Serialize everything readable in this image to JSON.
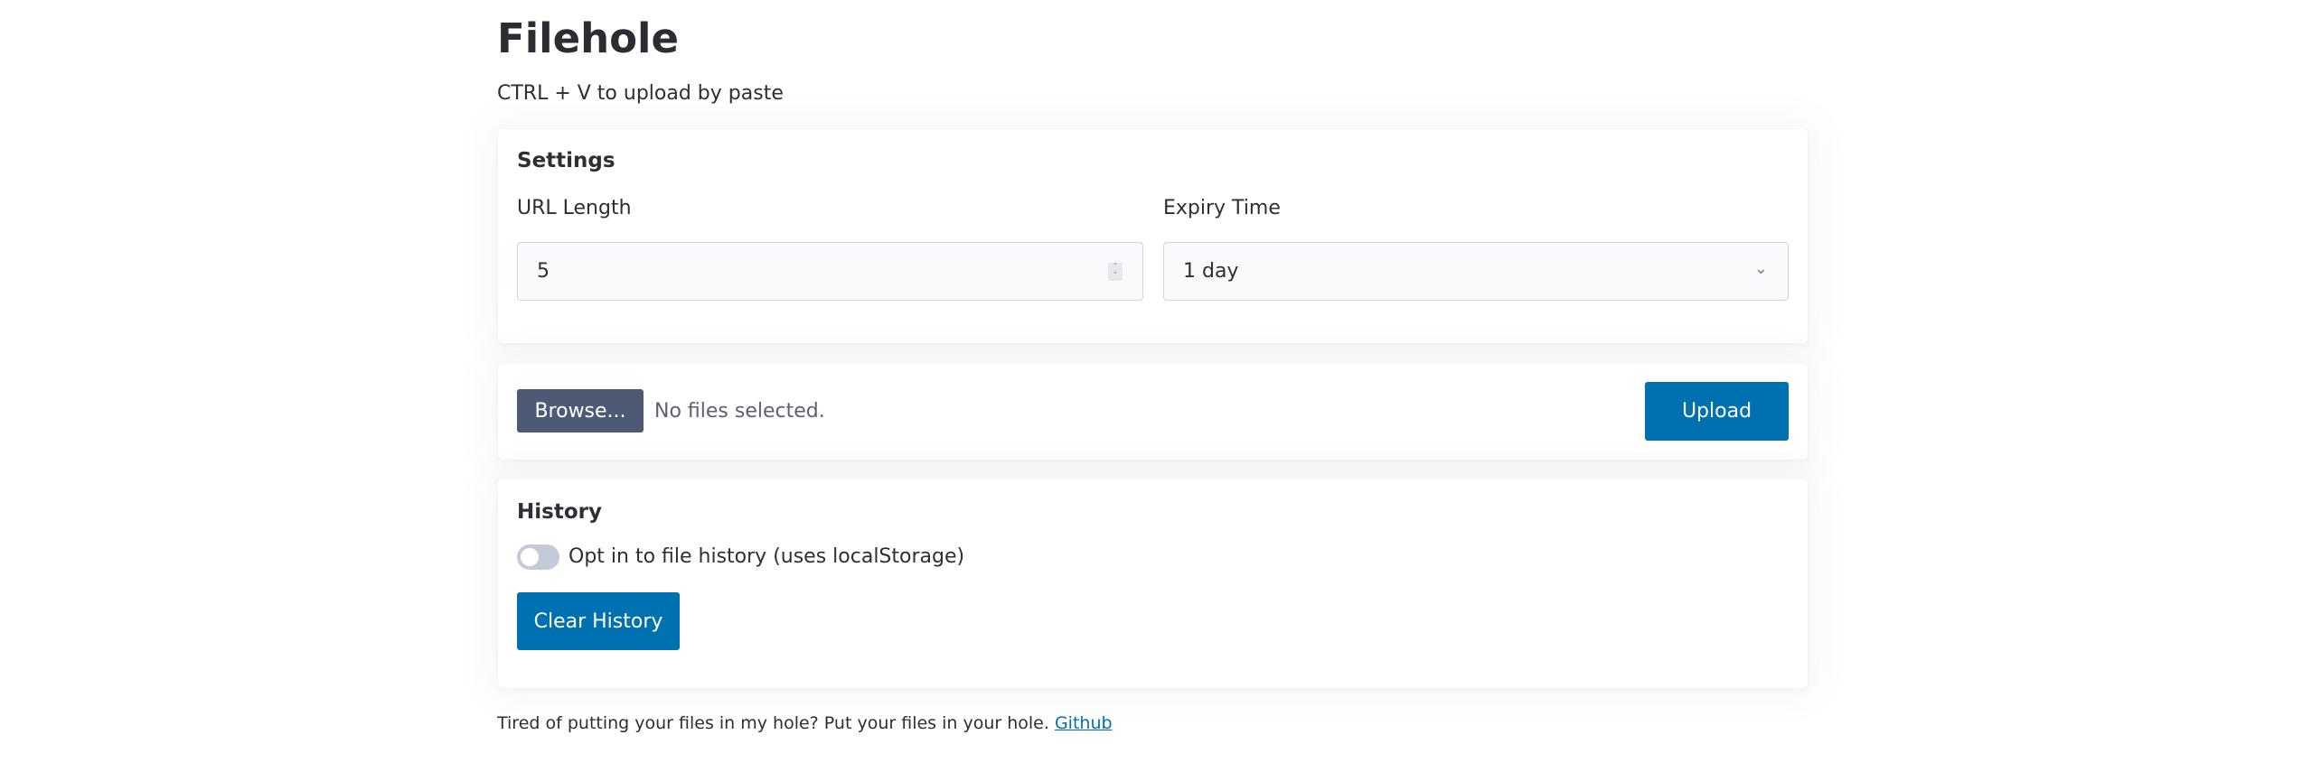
{
  "title": "Filehole",
  "subtitle": "CTRL + V to upload by paste",
  "settings": {
    "heading": "Settings",
    "url_length_label": "URL Length",
    "url_length_value": "5",
    "expiry_label": "Expiry Time",
    "expiry_value": "1 day"
  },
  "upload": {
    "browse_label": "Browse...",
    "file_status": "No files selected.",
    "upload_label": "Upload"
  },
  "history": {
    "heading": "History",
    "toggle_label": "Opt in to file history (uses localStorage)",
    "toggle_on": false,
    "clear_label": "Clear History"
  },
  "footer": {
    "text": "Tired of putting your files in my hole? Put your files in your hole.",
    "link": "Github"
  },
  "colors": {
    "accent": "#0071b0",
    "browse": "#4e5a75"
  }
}
